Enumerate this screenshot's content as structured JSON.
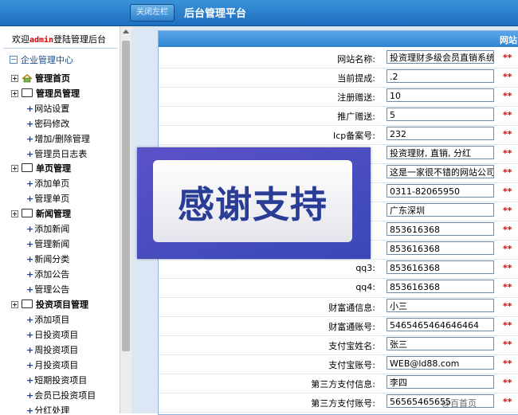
{
  "topbar": {
    "toggle_label": "关闭左栏",
    "title": "后台管理平台"
  },
  "sidebar": {
    "welcome_pre": "欢迎",
    "welcome_user": "admin",
    "welcome_post": "登陆管理后台",
    "root": "企业管理中心",
    "groups": [
      {
        "label": "管理首页",
        "items": []
      },
      {
        "label": "管理员管理",
        "items": [
          "网站设置",
          "密码修改",
          "增加/删除管理",
          "管理员日志表"
        ]
      },
      {
        "label": "单页管理",
        "items": [
          "添加单页",
          "管理单页"
        ]
      },
      {
        "label": "新闻管理",
        "items": [
          "添加新闻",
          "管理新闻",
          "新闻分类",
          "添加公告",
          "管理公告"
        ]
      },
      {
        "label": "投资项目管理",
        "items": [
          "添加项目",
          "日投资项目",
          "周投资项目",
          "月投资项目",
          "短期投资项目",
          "会员已投资项目",
          "分红处理"
        ]
      }
    ]
  },
  "panel": {
    "title": "网站"
  },
  "form": {
    "required_mark": "**",
    "rows": [
      {
        "label": "网站名称:",
        "value": "投资理财多级会员直销系统免费"
      },
      {
        "label": "当前提成:",
        "value": ".2"
      },
      {
        "label": "注册赠送:",
        "value": "10"
      },
      {
        "label": "推广赠送:",
        "value": "5"
      },
      {
        "label": "Icp备案号:",
        "value": "232"
      },
      {
        "label": "",
        "value": "投资理财, 直销, 分红"
      },
      {
        "label": "",
        "value": "这是一家很不错的网站公司"
      },
      {
        "label": "",
        "value": "0311-82065950"
      },
      {
        "label": "",
        "value": "广东深圳"
      },
      {
        "label": "",
        "value": "853616368"
      },
      {
        "label": "",
        "value": "853616368"
      },
      {
        "label": "qq3:",
        "value": "853616368"
      },
      {
        "label": "qq4:",
        "value": "853616368"
      },
      {
        "label": "财富通信息:",
        "value": "小三"
      },
      {
        "label": "财富通账号:",
        "value": "5465465464646464"
      },
      {
        "label": "支付宝姓名:",
        "value": "张三"
      },
      {
        "label": "支付宝账号:",
        "value": "WEB@ld88.com"
      },
      {
        "label": "第三方支付信息:",
        "value": "李四"
      },
      {
        "label": "第三方支付账号:",
        "value": "56565465655"
      }
    ]
  },
  "overlay": {
    "text": "感谢支持"
  },
  "watermark": "@百首页"
}
